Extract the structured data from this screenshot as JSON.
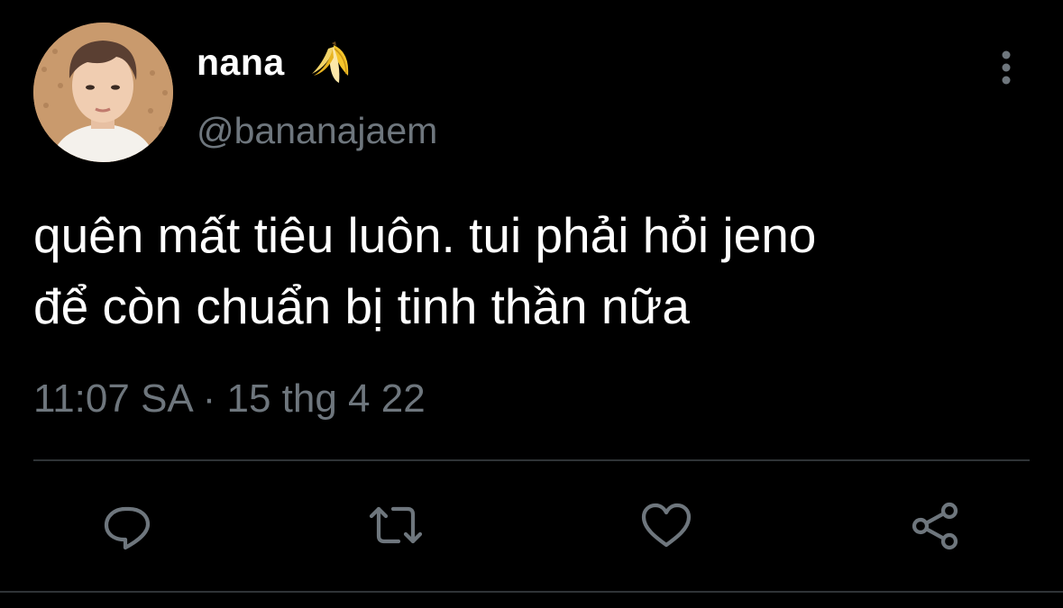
{
  "tweet": {
    "author": {
      "display_name": "nana",
      "name_emoji": "banana-icon",
      "handle": "@bananajaem",
      "avatar": "avatar-photo"
    },
    "text_lines": [
      "quên mất tiêu luôn. tui phải hỏi jeno",
      "để còn chuẩn bị tinh thần nữa"
    ],
    "timestamp": {
      "time": "11:07 SA",
      "separator": "·",
      "date": "15 thg 4 22"
    },
    "actions": [
      "reply-icon",
      "retweet-icon",
      "like-icon",
      "share-icon"
    ],
    "menu": "more-options-icon"
  },
  "colors": {
    "background": "#000000",
    "primary_text": "#ffffff",
    "secondary_text": "#6e767d",
    "divider": "#2f3336",
    "icon": "#6e767d"
  }
}
